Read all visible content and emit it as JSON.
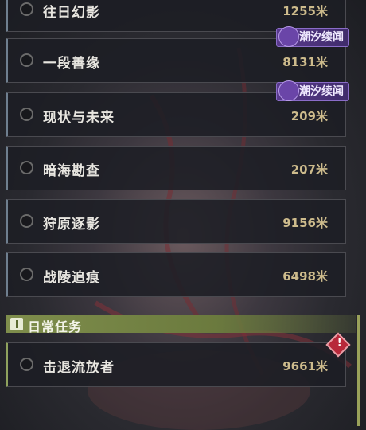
{
  "quests": [
    {
      "name": "往日幻影",
      "distance": "1255米",
      "tag": ""
    },
    {
      "name": "一段善缘",
      "distance": "8131米",
      "tag": "潮汐续闻"
    },
    {
      "name": "现状与未来",
      "distance": "209米",
      "tag": "潮汐续闻"
    },
    {
      "name": "暗海勘查",
      "distance": "207米",
      "tag": ""
    },
    {
      "name": "狩原逐影",
      "distance": "9156米",
      "tag": ""
    },
    {
      "name": "战陵追痕",
      "distance": "6498米",
      "tag": ""
    }
  ],
  "daily_section": {
    "title": "日常任务",
    "quests": [
      {
        "name": "击退流放者",
        "distance": "9661米",
        "alert": "!"
      }
    ]
  },
  "colors": {
    "accent_daily": "#8fa25e",
    "tag_purple": "#5a3a8e",
    "alert_red": "#b8283a"
  },
  "icons": {
    "tag": "tide-swirl-icon",
    "section": "daily-task-icon",
    "alert": "alert-diamond-icon"
  }
}
